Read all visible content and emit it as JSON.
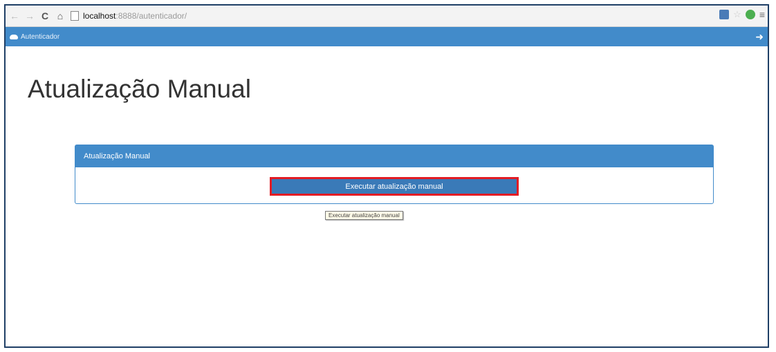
{
  "browser": {
    "url_host": "localhost",
    "url_rest": ":8888/autenticador/",
    "icons": [
      "back-arrow-icon",
      "forward-arrow-icon",
      "reload-icon",
      "home-icon",
      "page-icon",
      "extension-icon",
      "star-icon",
      "chat-extension-icon",
      "menu-icon"
    ]
  },
  "app": {
    "brand": "Autenticador",
    "accent": "#428bca"
  },
  "page": {
    "title": "Atualização Manual"
  },
  "panel": {
    "heading": "Atualização Manual",
    "button_label": "Executar atualização manual",
    "highlight_color": "#e31b23"
  },
  "tooltip": {
    "text": "Executar atualização manual"
  }
}
